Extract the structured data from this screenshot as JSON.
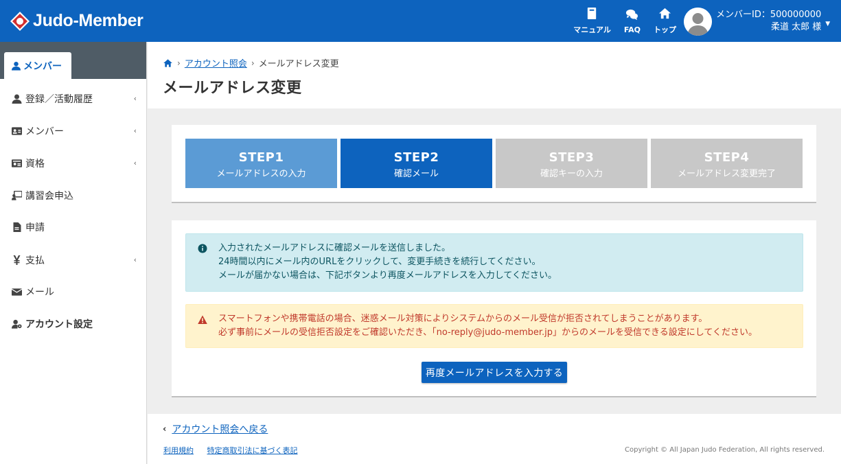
{
  "header": {
    "logo_text": "Judo-Member",
    "nav": [
      {
        "label": "マニュアル",
        "icon": "book-icon"
      },
      {
        "label": "FAQ",
        "icon": "comments-icon"
      },
      {
        "label": "トップ",
        "icon": "home-icon"
      }
    ],
    "user_id": "メンバーID：500000000",
    "user_name": "柔道 太郎 様"
  },
  "sidebar": {
    "active_tab": "メンバー",
    "items": [
      {
        "label": "登録／活動履歴",
        "icon": "user-icon",
        "chevron": "‹"
      },
      {
        "label": "メンバー",
        "icon": "id-card-icon",
        "chevron": "‹"
      },
      {
        "label": "資格",
        "icon": "certificate-icon",
        "chevron": "‹"
      },
      {
        "label": "講習会申込",
        "icon": "chalkboard-icon"
      },
      {
        "label": "申請",
        "icon": "file-icon"
      },
      {
        "label": "支払",
        "icon": "yen-icon",
        "chevron": "‹"
      },
      {
        "label": "メール",
        "icon": "envelope-icon"
      },
      {
        "label": "アカウント設定",
        "icon": "user-gear-icon"
      }
    ]
  },
  "breadcrumb": {
    "link": "アカウント照会",
    "current": "メールアドレス変更"
  },
  "page_title": "メールアドレス変更",
  "steps": [
    {
      "title": "STEP1",
      "sub": "メールアドレスの入力",
      "state": "done",
      "color": "#5b9bd5"
    },
    {
      "title": "STEP2",
      "sub": "確認メール",
      "state": "active",
      "color": "#0d63be"
    },
    {
      "title": "STEP3",
      "sub": "確認キーの入力",
      "state": "pending",
      "color": "#c8c8c8"
    },
    {
      "title": "STEP4",
      "sub": "メールアドレス変更完了",
      "state": "pending",
      "color": "#c8c8c8"
    }
  ],
  "info_alert": {
    "line1": "入力されたメールアドレスに確認メールを送信しました。",
    "line2": "24時間以内にメール内のURLをクリックして、変更手続きを続行してください。",
    "line3": "メールが届かない場合は、下記ボタンより再度メールアドレスを入力してください。"
  },
  "warn_alert": {
    "line1": "スマートフォンや携帯電話の場合、迷惑メール対策によりシステムからのメール受信が拒否されてしまうことがあります。",
    "line2": "必ず事前にメールの受信拒否設定をご確認いただき、「no-reply@judo-member.jp」からのメールを受信できる設定にしてください。"
  },
  "resend_button": "再度メールアドレスを入力する",
  "footer": {
    "back_link": "アカウント照会へ戻る",
    "links": [
      "利用規約",
      "特定商取引法に基づく表記"
    ],
    "copyright": "Copyright © All Japan Judo Federation, All rights reserved."
  },
  "colors": {
    "brand": "#0d63be",
    "sidebar_top": "#4f5c66",
    "info_bg": "#d1ecf1",
    "warn_bg": "#fff3cd",
    "warn_text": "#c0392b"
  }
}
